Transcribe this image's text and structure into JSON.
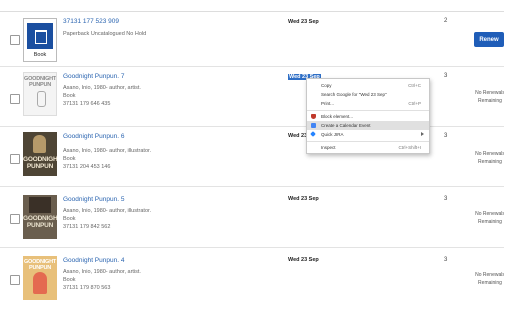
{
  "rows": [
    {
      "title": "37131 177 523 909",
      "meta1": "Paperback Uncatalogued No Hold",
      "cover_label": "Book",
      "date": "Wed 23 Sep",
      "count": "2",
      "action": "Renew"
    },
    {
      "title": "Goodnight Punpun. 7",
      "cover_text": "GOODNIGHT PUNPUN",
      "author": "Asano, Inio, 1980- author, artist.",
      "format": "Book",
      "barcode": "37131 179 646 435",
      "date": "Wed 23 Sep",
      "count": "3",
      "status_line1": "No Renewals",
      "status_line2": "Remaining"
    },
    {
      "title": "Goodnight Punpun. 6",
      "cover_text": "GOODNIGHT PUNPUN",
      "author": "Asano, Inio, 1980- author, illustrator.",
      "format": "Book",
      "barcode": "37131 204 453 146",
      "date": "Wed 23 Sep",
      "count": "3",
      "status_line1": "No Renewals",
      "status_line2": "Remaining"
    },
    {
      "title": "Goodnight Punpun. 5",
      "cover_text": "GOODNIGHT PUNPUN",
      "author": "Asano, Inio, 1980- author, illustrator.",
      "format": "Book",
      "barcode": "37131 179 842 562",
      "date": "Wed 23 Sep",
      "count": "3",
      "status_line1": "No Renewals",
      "status_line2": "Remaining"
    },
    {
      "title": "Goodnight Punpun. 4",
      "cover_text": "GOODNIGHT PUNPUN",
      "author": "Asano, Inio, 1980- author, artist.",
      "format": "Book",
      "barcode": "37131 179 870 563",
      "date": "Wed 23 Sep",
      "count": "3",
      "status_line1": "No Renewals",
      "status_line2": "Remaining"
    }
  ],
  "context_menu": {
    "items": [
      {
        "label": "Copy",
        "shortcut": "Ctrl+C"
      },
      {
        "label": "Search Google for \"Wed 23 Sep\""
      },
      {
        "label": "Print...",
        "shortcut": "Ctrl+P"
      },
      {
        "label": "Block element...",
        "icon": "shield-icon",
        "icon_color": "#c0392b"
      },
      {
        "label": "Create a Calendar Event",
        "icon": "calendar-icon",
        "icon_color": "#4285f4"
      },
      {
        "label": "Quick JIRA",
        "icon": "jira-icon",
        "icon_color": "#2684ff"
      },
      {
        "label": "Inspect",
        "shortcut": "Ctrl+Shift+I"
      }
    ]
  },
  "colors": {
    "link": "#2a64b0",
    "renew_button": "#1f5db8",
    "selection": "#2f6fc6"
  }
}
